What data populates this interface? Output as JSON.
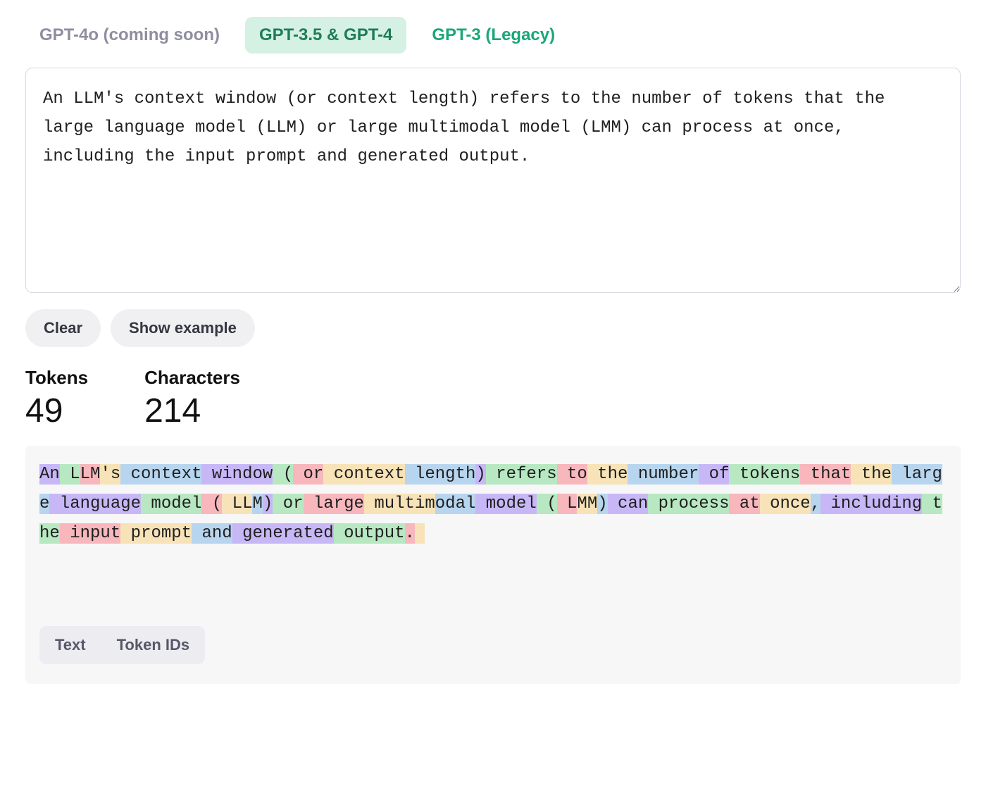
{
  "tabs": [
    {
      "label": "GPT-4o (coming soon)",
      "state": "inactive-first"
    },
    {
      "label": "GPT-3.5 & GPT-4",
      "state": "active"
    },
    {
      "label": "GPT-3 (Legacy)",
      "state": "inactive"
    }
  ],
  "input_text": "An LLM's context window (or context length) refers to the number of tokens that the large language model (LLM) or large multimodal model (LMM) can process at once, including the input prompt and generated output.",
  "buttons": {
    "clear": "Clear",
    "example": "Show example"
  },
  "stats": {
    "tokens_label": "Tokens",
    "tokens": "49",
    "chars_label": "Characters",
    "chars": "214"
  },
  "tokens": [
    "An",
    " L",
    "LM",
    "'s",
    " context",
    " window",
    " (",
    " or",
    " context",
    " length",
    ")",
    " refers",
    " to",
    " the",
    " number",
    " of",
    " tokens",
    " that",
    " the",
    " large",
    " language",
    " model",
    " (",
    " LL",
    "M",
    ")",
    " or",
    " large",
    " multim",
    "odal",
    " model",
    " (",
    " L",
    "MM",
    ")",
    " can",
    " process",
    " at",
    " once",
    ",",
    " including",
    " the",
    " input",
    " prompt",
    " and",
    " generated",
    " output",
    ".",
    " "
  ],
  "viz_tabs": {
    "text": "Text",
    "ids": "Token IDs"
  }
}
